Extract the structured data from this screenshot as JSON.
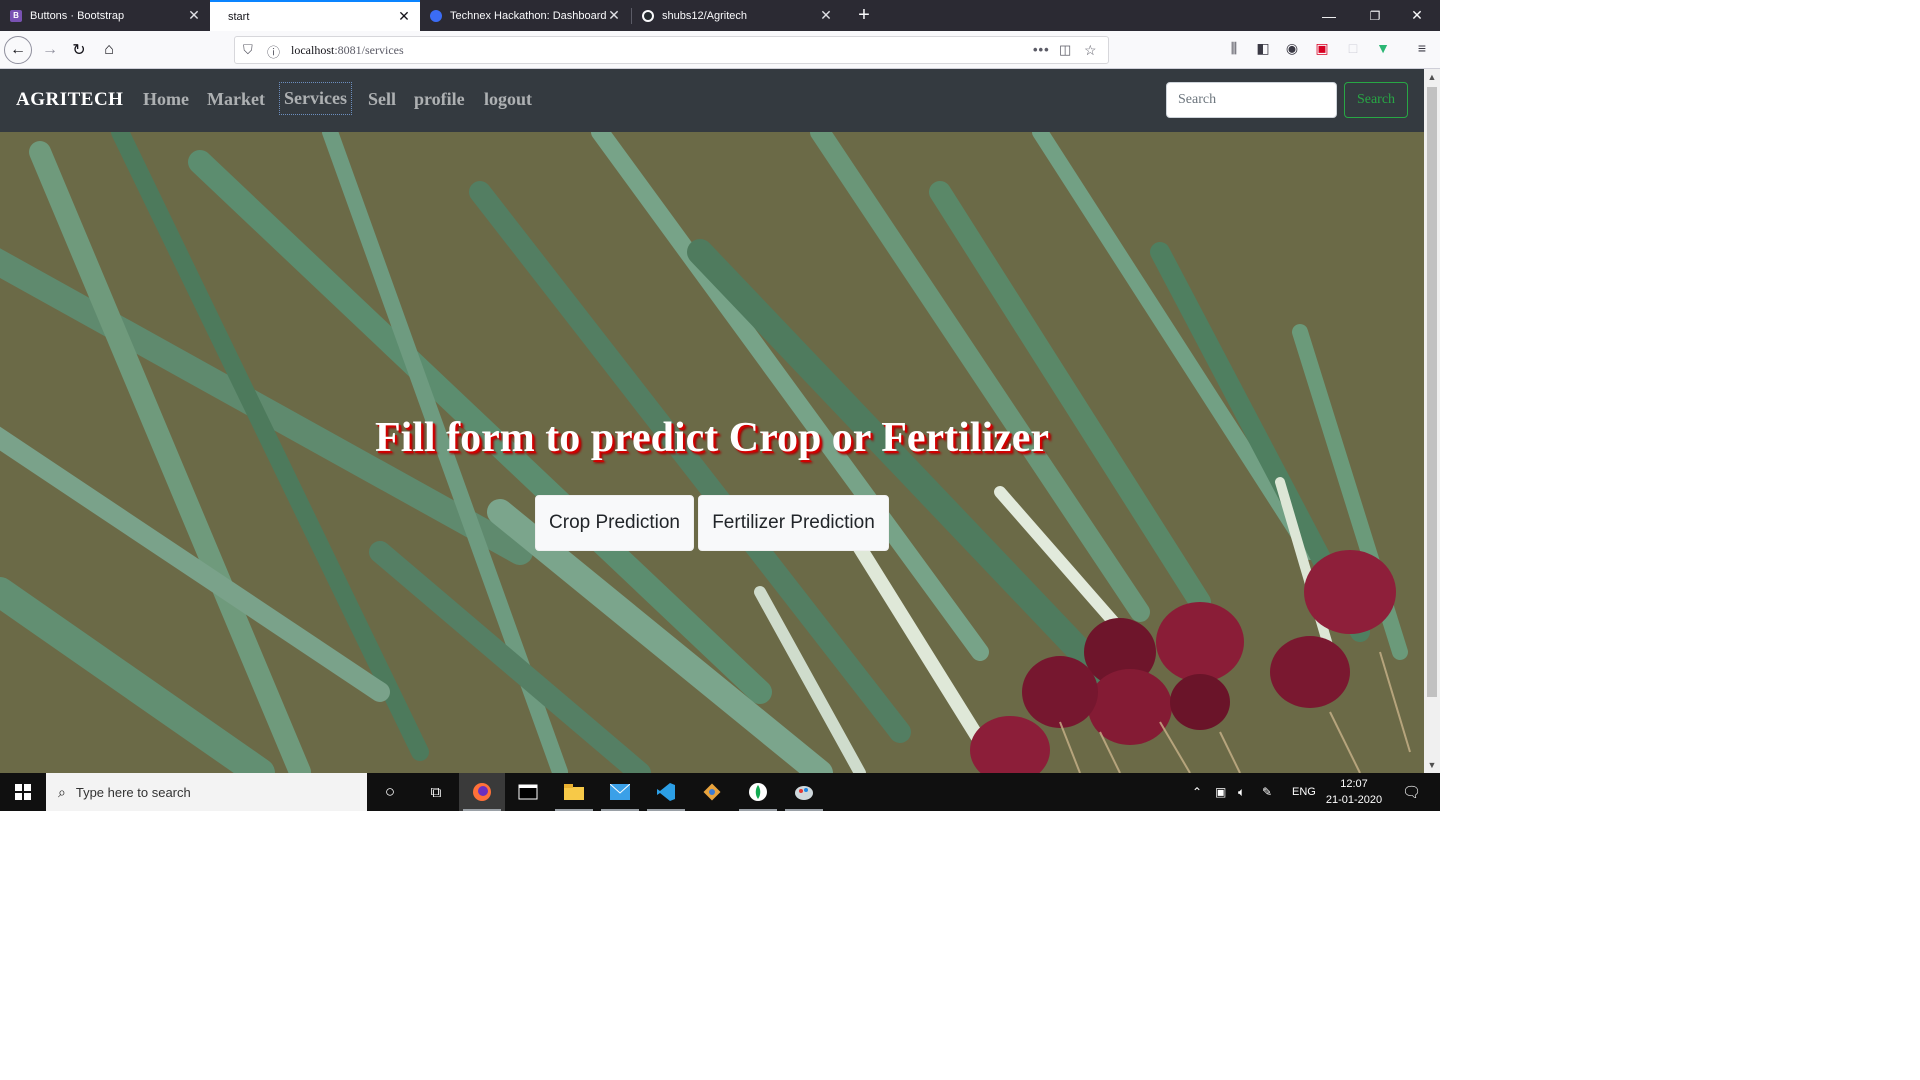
{
  "browser": {
    "tabs": [
      {
        "title": "Buttons · Bootstrap",
        "favicon": "bootstrap-icon",
        "color": "#7952b3"
      },
      {
        "title": "start",
        "favicon": "none",
        "active": true
      },
      {
        "title": "Technex Hackathon: Dashboard",
        "favicon": "dashboard-icon",
        "color": "#3b6cf5"
      },
      {
        "title": "shubs12/Agritech",
        "favicon": "github-icon",
        "color": "#24292e"
      }
    ],
    "url_prefix": "localhost",
    "url_rest": ":8081/services"
  },
  "navbar": {
    "brand": "AGRITECH",
    "links": [
      "Home",
      "Market",
      "Services",
      "Sell",
      "profile",
      "logout"
    ],
    "active_link": "Services",
    "search_placeholder": "Search",
    "search_button": "Search"
  },
  "hero": {
    "title": "Fill form to predict Crop or Fertilizer",
    "buttons": [
      "Crop Prediction",
      "Fertilizer Prediction"
    ]
  },
  "taskbar": {
    "search_placeholder": "Type here to search",
    "language": "ENG",
    "time": "12:07",
    "date": "21-01-2020"
  },
  "colors": {
    "navbar_bg": "#343a40",
    "search_green": "#28a745",
    "title_shadow": "#d00000",
    "tab_accent": "#0a84ff"
  }
}
